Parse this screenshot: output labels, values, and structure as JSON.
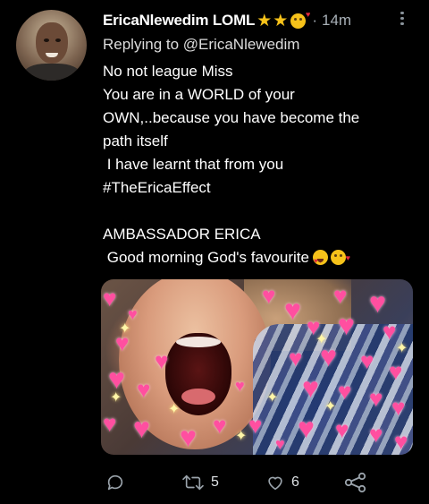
{
  "tweet": {
    "display_name": "EricaNlewedim LOML",
    "timestamp": "14m",
    "separator": "·",
    "reply_prefix": "Replying to",
    "reply_handle": "@EricaNlewedim",
    "body_lines": [
      "No not league Miss",
      "You are in a WORLD of your",
      "OWN,..because you have become the",
      "path itself",
      " I have learnt that from you",
      "#TheEricaEffect",
      "",
      "AMBASSADOR ERICA",
      " Good morning God's favourite"
    ],
    "name_emojis": [
      "star-icon",
      "star-icon",
      "kissing-face-icon"
    ],
    "last_line_emojis": [
      "heart-eyes-icon",
      "kissing-face-icon"
    ],
    "media_description_icon": "crying-child-with-hearts-image"
  },
  "actions": {
    "reply_count": "",
    "retweet_count": "5",
    "like_count": "6",
    "icons": [
      "reply-icon",
      "retweet-icon",
      "like-icon",
      "share-icon"
    ]
  },
  "colors": {
    "background": "#000000",
    "text": "#ffffff",
    "muted": "#a8b0b7",
    "star": "#f6c21a"
  }
}
